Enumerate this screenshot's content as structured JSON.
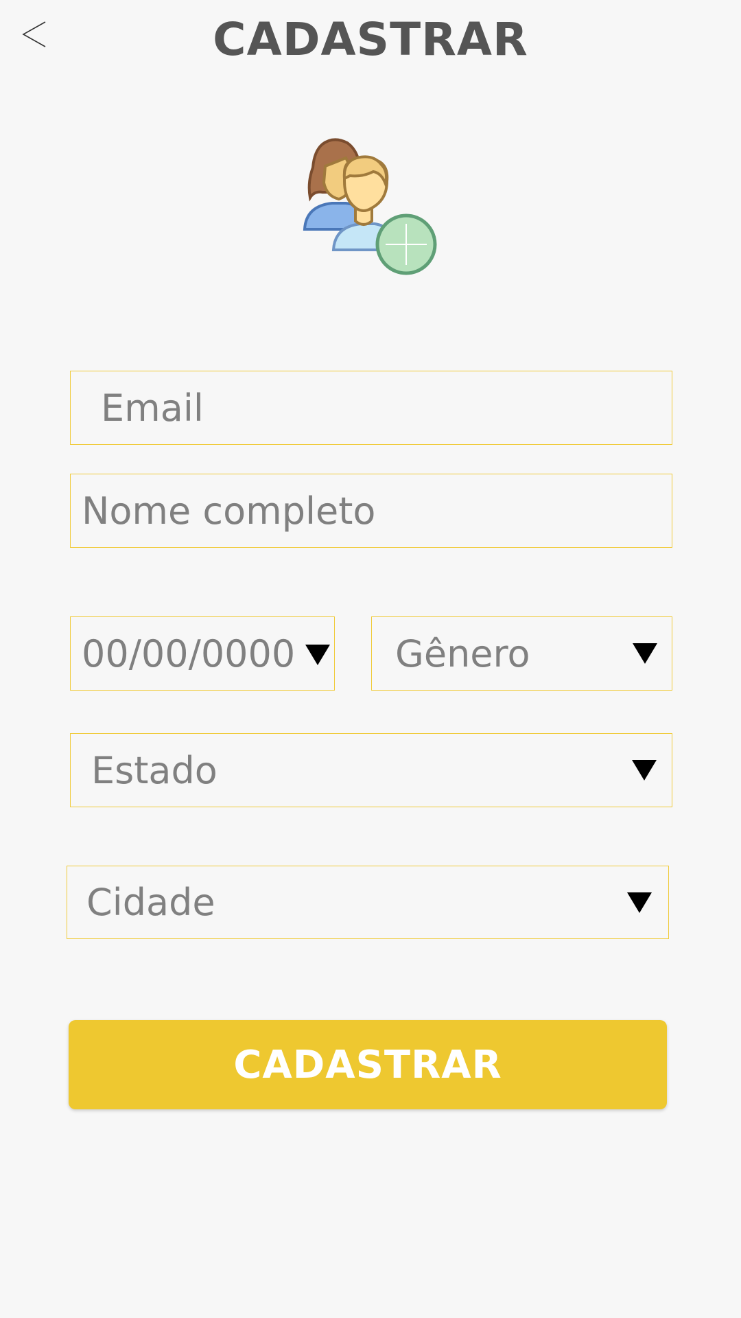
{
  "header": {
    "title": "CADASTRAR",
    "back_icon": "chevron-left-icon"
  },
  "hero": {
    "icon": "add-user-group-icon"
  },
  "form": {
    "email": {
      "placeholder": "Email"
    },
    "full_name": {
      "placeholder": "Nome completo"
    },
    "birth_date": {
      "placeholder": "00/00/0000"
    },
    "gender": {
      "label": "Gênero"
    },
    "state": {
      "label": "Estado"
    },
    "city": {
      "label": "Cidade"
    }
  },
  "submit": {
    "label": "CADASTRAR"
  },
  "colors": {
    "accent": "#eec830",
    "field_border": "#f0cb3a",
    "title_text": "#555555",
    "placeholder_text": "#808080",
    "background": "#f7f7f7"
  }
}
